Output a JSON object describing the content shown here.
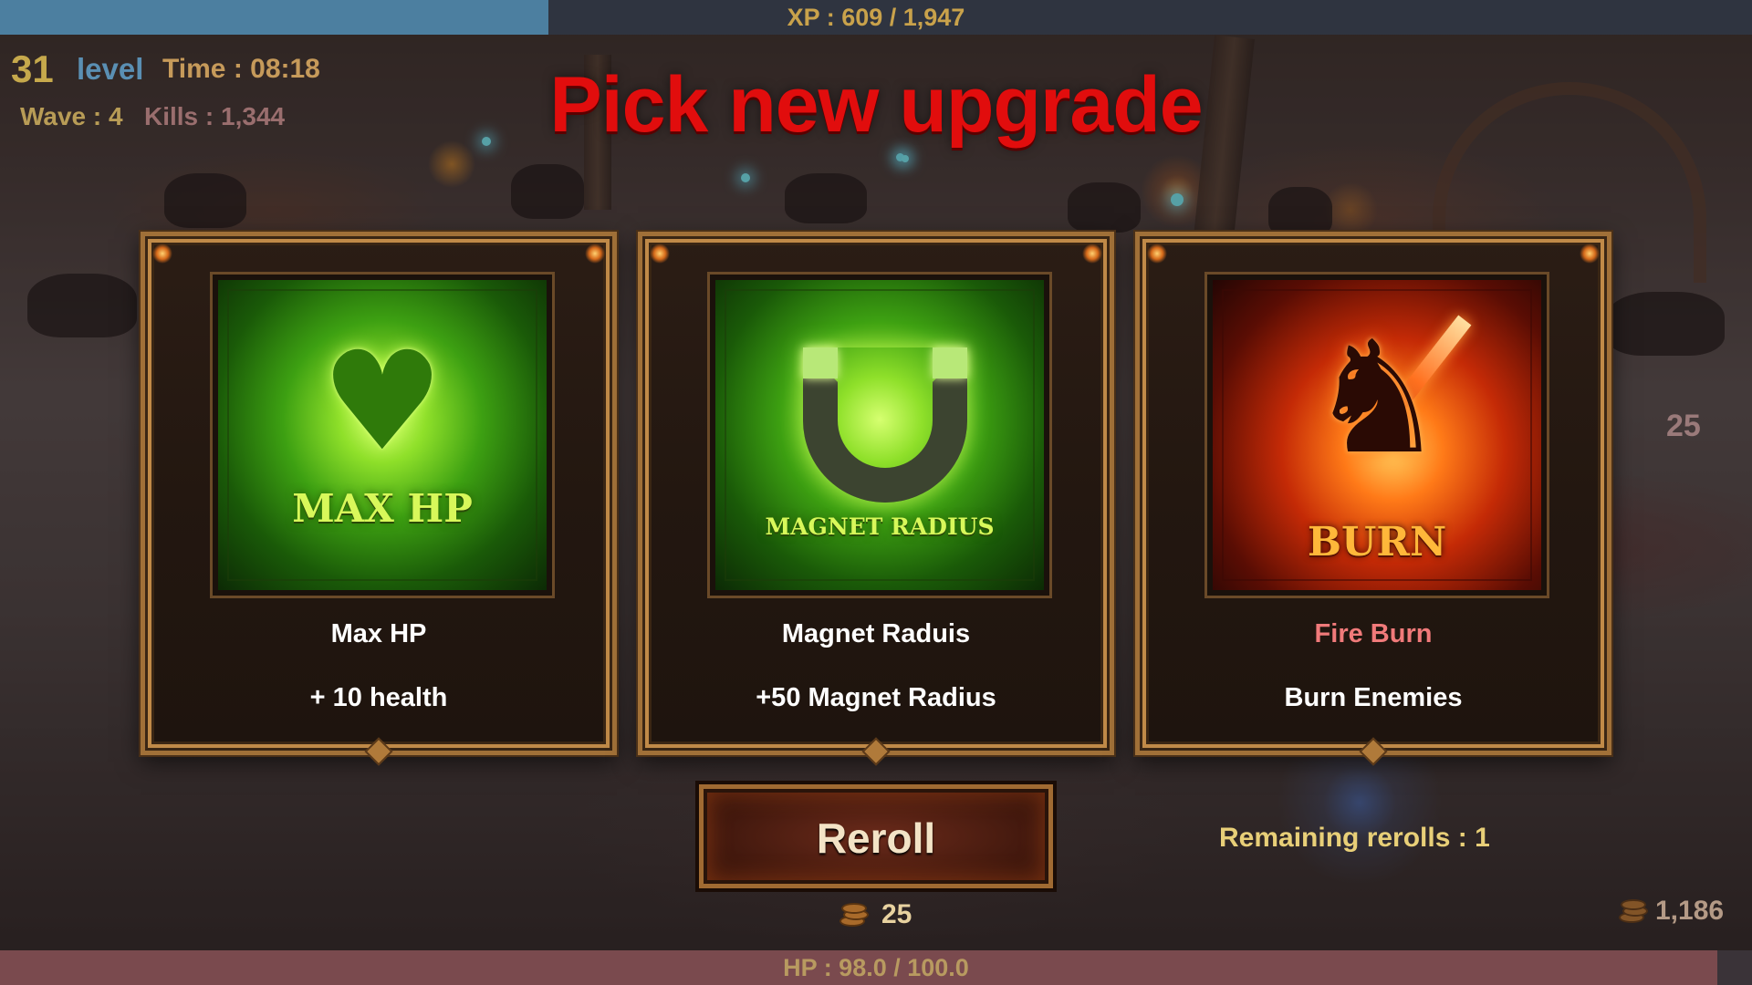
{
  "hud": {
    "xp_text": "XP : 609 / 1,947",
    "xp_current": 609,
    "xp_max": 1947,
    "level_number": "31",
    "level_label": "level",
    "time": "Time : 08:18",
    "wave": "Wave : 4",
    "kills": "Kills : 1,344",
    "side_number": "25"
  },
  "headline": "Pick new upgrade",
  "cards": [
    {
      "art_title": "MAX HP",
      "art_icon": "heart-icon",
      "art_theme": "green",
      "name": "Max HP",
      "description": "+ 10 health"
    },
    {
      "art_title": "MAGNET RADIUS",
      "art_icon": "magnet-icon",
      "art_theme": "green",
      "name": "Magnet Raduis",
      "description": "+50 Magnet Radius"
    },
    {
      "art_title": "BURN",
      "art_icon": "dragon-icon",
      "art_theme": "fire",
      "name": "Fire Burn",
      "description": "Burn Enemies"
    }
  ],
  "reroll": {
    "label": "Reroll",
    "cost": "25",
    "remaining": "Remaining rerolls : 1"
  },
  "gold_total": "1,186",
  "hp": {
    "text": "HP : 98.0 / 100.0",
    "current": 98.0,
    "max": 100.0
  },
  "colors": {
    "headline": "#e10d0d",
    "xp_fill": "#4c7fa0",
    "hp_fill": "#7a4a4e",
    "card_border": "#a07038",
    "fire_name": "#f07a7a"
  }
}
